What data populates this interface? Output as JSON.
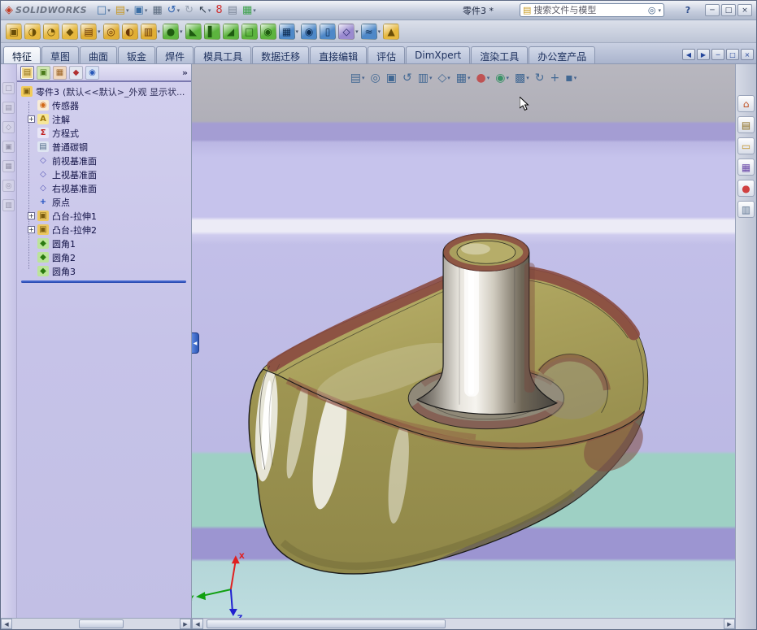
{
  "window": {
    "app_name": "SOLIDWORKS",
    "logo_glyph": "◈",
    "doc_title": "零件3 *",
    "search_placeholder": "搜索文件与模型",
    "help_label": "?",
    "controls": [
      {
        "name": "minimize-button",
        "g": "─"
      },
      {
        "name": "maximize-button",
        "g": "□"
      },
      {
        "name": "close-button",
        "g": "×"
      }
    ],
    "titlebar_icons": [
      {
        "name": "new-document-icon",
        "g": "□",
        "t": "#3a6ea5",
        "dd": "▾"
      },
      {
        "name": "open-icon",
        "g": "▤",
        "t": "#c8961e",
        "dd": "▾"
      },
      {
        "name": "save-icon",
        "g": "▣",
        "t": "#3a6ea5",
        "dd": "▾"
      },
      {
        "name": "print-icon",
        "g": "▦",
        "t": "#5a6a7e"
      },
      {
        "name": "undo-icon",
        "g": "↺",
        "t": "#2e62b0",
        "dd": "▾"
      },
      {
        "name": "redo-icon",
        "g": "↻",
        "t": "#9aa4b4"
      },
      {
        "name": "select-icon",
        "g": "↖",
        "t": "#33404f",
        "dd": "▾"
      },
      {
        "name": "rebuild-icon",
        "g": "8",
        "t": "#d03030"
      },
      {
        "name": "file-properties-icon",
        "g": "▤",
        "t": "#7a8496"
      },
      {
        "name": "options-icon",
        "g": "▦",
        "t": "#3aa048",
        "dd": "▾"
      }
    ]
  },
  "toolbar2": {
    "icons": [
      {
        "name": "extruded-boss-icon",
        "g": "▣",
        "c": "#e6b83e",
        "t": "#6a4e08"
      },
      {
        "name": "revolved-boss-icon",
        "g": "◑",
        "c": "#e6b83e",
        "t": "#6a4e08"
      },
      {
        "name": "swept-boss-icon",
        "g": "◔",
        "c": "#e6b83e",
        "t": "#6a4e08"
      },
      {
        "name": "lofted-boss-icon",
        "g": "◆",
        "c": "#e6b83e",
        "t": "#6a4e08"
      },
      {
        "name": "extruded-cut-icon",
        "g": "▤",
        "c": "#e0ae34",
        "t": "#6a3608",
        "dd": "▾"
      },
      {
        "name": "hole-wizard-icon",
        "g": "◎",
        "c": "#e0ae34",
        "t": "#6a3608"
      },
      {
        "name": "revolved-cut-icon",
        "g": "◐",
        "c": "#e0ae34",
        "t": "#6a3608"
      },
      {
        "name": "swept-cut-icon",
        "g": "▥",
        "c": "#e0ae34",
        "t": "#6a3608",
        "dd": "▾"
      },
      {
        "name": "fillet-icon",
        "g": "●",
        "c": "#5cb43e",
        "t": "#1e5a10",
        "dd": "▾"
      },
      {
        "name": "chamfer-icon",
        "g": "◣",
        "c": "#5cb43e",
        "t": "#1e5a10"
      },
      {
        "name": "rib-icon",
        "g": "▌",
        "c": "#5cb43e",
        "t": "#1e5a10"
      },
      {
        "name": "draft-icon",
        "g": "◢",
        "c": "#5cb43e",
        "t": "#1e5a10"
      },
      {
        "name": "shell-icon",
        "g": "□",
        "c": "#5cb43e",
        "t": "#1e5a10"
      },
      {
        "name": "wrap-icon",
        "g": "◉",
        "c": "#5cb43e",
        "t": "#1e5a10"
      },
      {
        "name": "linear-pattern-icon",
        "g": "▦",
        "c": "#4e88c8",
        "t": "#0e2c52",
        "dd": "▾"
      },
      {
        "name": "circular-pattern-icon",
        "g": "◉",
        "c": "#4e88c8",
        "t": "#0e2c52"
      },
      {
        "name": "mirror-icon",
        "g": "▯",
        "c": "#4e88c8",
        "t": "#0e2c52"
      },
      {
        "name": "reference-geometry-icon",
        "g": "◇",
        "c": "#9a8ad0",
        "t": "#26266a",
        "dd": "▾"
      },
      {
        "name": "curves-icon",
        "g": "≈",
        "c": "#4e88c8",
        "t": "#0e2c52",
        "dd": "▾"
      },
      {
        "name": "instant3d-icon",
        "g": "▲",
        "c": "#e6b83e",
        "t": "#6a4e08"
      }
    ]
  },
  "tabs": [
    {
      "name": "tab-features",
      "label": "特征",
      "cls": "active"
    },
    {
      "name": "tab-sketch",
      "label": "草图"
    },
    {
      "name": "tab-surfaces",
      "label": "曲面"
    },
    {
      "name": "tab-sheet-metal",
      "label": "钣金"
    },
    {
      "name": "tab-weldments",
      "label": "焊件"
    },
    {
      "name": "tab-mold-tools",
      "label": "模具工具"
    },
    {
      "name": "tab-data-migration",
      "label": "数据迁移"
    },
    {
      "name": "tab-direct-editing",
      "label": "直接编辑"
    },
    {
      "name": "tab-evaluate",
      "label": "评估"
    },
    {
      "name": "tab-dimxpert",
      "label": "DimXpert"
    },
    {
      "name": "tab-render-tools",
      "label": "渲染工具"
    },
    {
      "name": "tab-office-products",
      "label": "办公室产品"
    }
  ],
  "doc_controls": [
    {
      "name": "doc-back-button",
      "g": "◀"
    },
    {
      "name": "doc-forward-button",
      "g": "▶"
    },
    {
      "name": "doc-minimize-button",
      "g": "─"
    },
    {
      "name": "doc-restore-button",
      "g": "□"
    },
    {
      "name": "doc-close-button",
      "g": "×"
    }
  ],
  "left_toolbar": {
    "icons": [
      {
        "name": "docked-toolbar-icon-1",
        "g": "□"
      },
      {
        "name": "docked-toolbar-icon-2",
        "g": "▤"
      },
      {
        "name": "docked-toolbar-icon-3",
        "g": "◇"
      },
      {
        "name": "docked-toolbar-icon-4",
        "g": "▣"
      },
      {
        "name": "docked-toolbar-icon-5",
        "g": "▦"
      },
      {
        "name": "docked-toolbar-icon-6",
        "g": "◎"
      },
      {
        "name": "docked-toolbar-icon-7",
        "g": "▥"
      }
    ]
  },
  "panel": {
    "manager_tabs": [
      {
        "name": "featuremanager-tab",
        "g": "▤",
        "c": "#f0d890",
        "t": "#8a6a10",
        "cls": "active"
      },
      {
        "name": "propertymanager-tab",
        "g": "▣",
        "c": "#cfe6b0",
        "t": "#4a7a1a"
      },
      {
        "name": "configurationmanager-tab",
        "g": "▦",
        "c": "#f0d8c0",
        "t": "#9a6020"
      },
      {
        "name": "dimxpertmanager-tab",
        "g": "◆",
        "c": "#e2e6f0",
        "t": "#b03030"
      },
      {
        "name": "displaymanager-tab",
        "g": "◉",
        "c": "#d8e2f4",
        "t": "#2858b8"
      }
    ],
    "more_label": "»",
    "tree": {
      "root_label": "零件3",
      "root_suffix": "(默认<<默认>_外观 显示状...",
      "items": [
        {
          "name": "tree-item-sensors",
          "label": "传感器",
          "g": "◉",
          "t": "#d06818",
          "c": "#f8ecd8"
        },
        {
          "name": "tree-item-annotations",
          "label": "注解",
          "exp": "+",
          "g": "A",
          "t": "#a07808",
          "c": "#f6e69a"
        },
        {
          "name": "tree-item-equations",
          "label": "方程式",
          "g": "Σ",
          "t": "#c02020",
          "c": "#e8e6f6"
        },
        {
          "name": "tree-item-material",
          "label": "普通碳钢",
          "g": "▤",
          "t": "#506a88",
          "c": "#dfe6f2"
        },
        {
          "name": "tree-item-front-plane",
          "label": "前视基准面",
          "g": "◇",
          "t": "#5858b8"
        },
        {
          "name": "tree-item-top-plane",
          "label": "上视基准面",
          "g": "◇",
          "t": "#5858b8"
        },
        {
          "name": "tree-item-right-plane",
          "label": "右视基准面",
          "g": "◇",
          "t": "#5858b8"
        },
        {
          "name": "tree-item-origin",
          "label": "原点",
          "g": "+",
          "t": "#2050c0"
        },
        {
          "name": "tree-item-boss-extrude1",
          "label": "凸台-拉伸1",
          "exp": "+",
          "g": "▣",
          "t": "#7a5c10",
          "c": "#ecc860"
        },
        {
          "name": "tree-item-boss-extrude2",
          "label": "凸台-拉伸2",
          "exp": "+",
          "g": "▣",
          "t": "#7a5c10",
          "c": "#ecc860"
        },
        {
          "name": "tree-item-fillet1",
          "label": "圆角1",
          "g": "◆",
          "t": "#2a7a10",
          "c": "#bce49a"
        },
        {
          "name": "tree-item-fillet2",
          "label": "圆角2",
          "g": "◆",
          "t": "#2a7a10",
          "c": "#bce49a"
        },
        {
          "name": "tree-item-fillet3",
          "label": "圆角3",
          "g": "◆",
          "t": "#2a7a10",
          "c": "#bce49a"
        }
      ]
    }
  },
  "headsup": {
    "icons": [
      {
        "name": "display-style-icon",
        "g": "▤",
        "t": "#35608f",
        "dd": "▾"
      },
      {
        "name": "zoom-fit-icon",
        "g": "◎",
        "t": "#35608f"
      },
      {
        "name": "zoom-area-icon",
        "g": "▣",
        "t": "#35608f"
      },
      {
        "name": "previous-view-icon",
        "g": "↺",
        "t": "#35608f"
      },
      {
        "name": "section-view-icon",
        "g": "▥",
        "t": "#35608f",
        "dd": "▾"
      },
      {
        "name": "view-orientation-icon",
        "g": "◇",
        "t": "#35608f",
        "dd": "▾"
      },
      {
        "name": "hide-show-items-icon",
        "g": "▦",
        "t": "#35608f",
        "dd": "▾"
      },
      {
        "name": "edit-appearance-icon",
        "g": "●",
        "t": "#c04848",
        "dd": "▾"
      },
      {
        "name": "apply-scene-icon",
        "g": "◉",
        "t": "#2e8f5e",
        "dd": "▾"
      },
      {
        "name": "view-settings-icon",
        "g": "▩",
        "t": "#35608f",
        "dd": "▾"
      },
      {
        "name": "rotate-view-icon",
        "g": "↻",
        "t": "#35608f"
      },
      {
        "name": "pan-icon",
        "g": "+",
        "t": "#35608f"
      },
      {
        "name": "camera-icon",
        "g": "▪",
        "t": "#35608f",
        "dd": "▾"
      }
    ]
  },
  "taskpane": {
    "icons": [
      {
        "name": "solidworks-resources-icon",
        "g": "⌂",
        "t": "#c05020"
      },
      {
        "name": "design-library-icon",
        "g": "▤",
        "t": "#8a6a1a"
      },
      {
        "name": "file-explorer-icon",
        "g": "▭",
        "t": "#c09020"
      },
      {
        "name": "view-palette-icon",
        "g": "▦",
        "t": "#6a48a8"
      },
      {
        "name": "appearances-icon",
        "g": "●",
        "t": "#d04040"
      },
      {
        "name": "custom-properties-icon",
        "g": "▥",
        "t": "#5a7290"
      }
    ]
  },
  "scrollbars": {
    "left_arrow": "◀",
    "right_arrow": "▶"
  },
  "viewport": {
    "triad": {
      "x": "X",
      "y": "Y",
      "z": "Z"
    }
  }
}
